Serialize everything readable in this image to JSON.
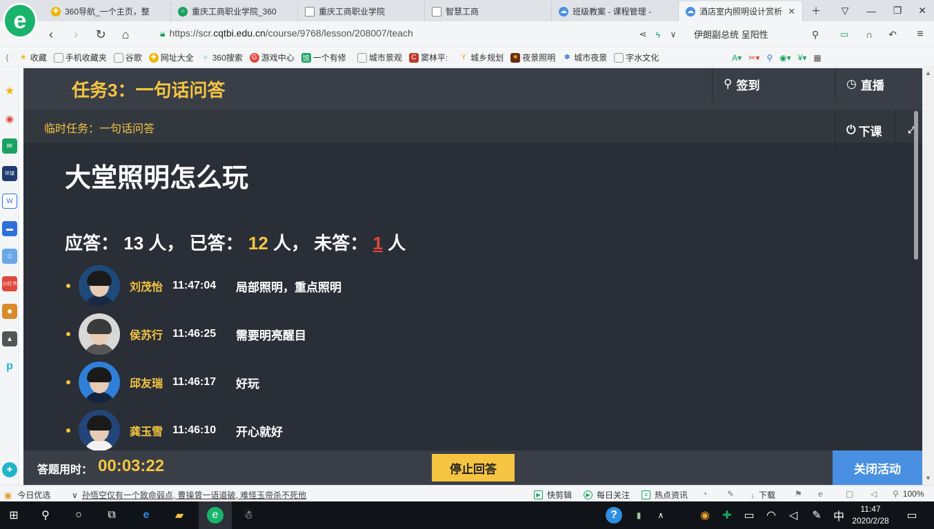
{
  "browser": {
    "tabs": [
      {
        "label": "360导航_一个主页，整",
        "icon_color": "#f0b400",
        "active": false
      },
      {
        "label": "重庆工商职业学院_360",
        "icon_color": "#1aa260",
        "active": false
      },
      {
        "label": "重庆工商职业学院",
        "icon_color": "#888888",
        "active": false
      },
      {
        "label": "智慧工商",
        "icon_color": "#888888",
        "active": false
      },
      {
        "label": "班级教案 - 课程管理 - ",
        "icon_color": "#4a90e2",
        "active": false
      },
      {
        "label": "酒店室内照明设计赏析",
        "icon_color": "#4a90e2",
        "active": true
      }
    ],
    "url_scheme": "https://scr.",
    "url_domain": "cqtbi.edu.cn",
    "url_path": "/course/9768/lesson/208007/teach",
    "nav_right_text": "伊朗副总统 呈阳性",
    "bookmarks": [
      "收藏",
      "手机收藏夹",
      "谷歌",
      "网址大全",
      "360搜索",
      "游戏中心",
      "一个有修",
      "城市景观",
      "窦林平:",
      "城乡规划",
      "夜景照明",
      "城市夜景",
      "字水文化"
    ]
  },
  "header": {
    "task_title": "任务3：一句话问答",
    "checkin_label": "签到",
    "live_label": "直播",
    "temp_task": "临时任务：一句话问答",
    "end_class_label": "下课"
  },
  "question": "大堂照明怎么玩",
  "stats": {
    "should_label": "应答：",
    "should_count": "13",
    "answered_label": "人， 已答：",
    "answered_count": "12",
    "unanswered_label": "人， 未答：",
    "unanswered_count": "1",
    "unit": "人"
  },
  "answers": [
    {
      "name": "刘茂怡",
      "time": "11:47:04",
      "text": "局部照明，重点照明"
    },
    {
      "name": "侯苏行",
      "time": "11:46:25",
      "text": "需要明亮醒目"
    },
    {
      "name": "邱友瑞",
      "time": "11:46:17",
      "text": "好玩"
    },
    {
      "name": "龚玉雪",
      "time": "11:46:10",
      "text": "开心就好"
    }
  ],
  "footer": {
    "elapsed_label": "答题用时：",
    "elapsed": "00:03:22",
    "stop_label": "停止回答",
    "close_label": "关闭活动"
  },
  "statusbar": {
    "today": "今日优选",
    "headline": "孙悟空仅有一个致命弱点, 曹操曾一语道破, 难怪玉帝杀不死他",
    "quick_edit": "快剪辑",
    "daily_focus": "每日关注",
    "hot_news": "热点资讯",
    "download": "下载",
    "zoom": "100%"
  },
  "taskbar": {
    "time": "11:47",
    "date": "2020/2/28",
    "ime": "中"
  },
  "colors": {
    "accent_yellow": "#f5c542",
    "content_bg": "#2a2e36",
    "close_blue": "#4a90e2",
    "alert_red": "#e0483c"
  }
}
